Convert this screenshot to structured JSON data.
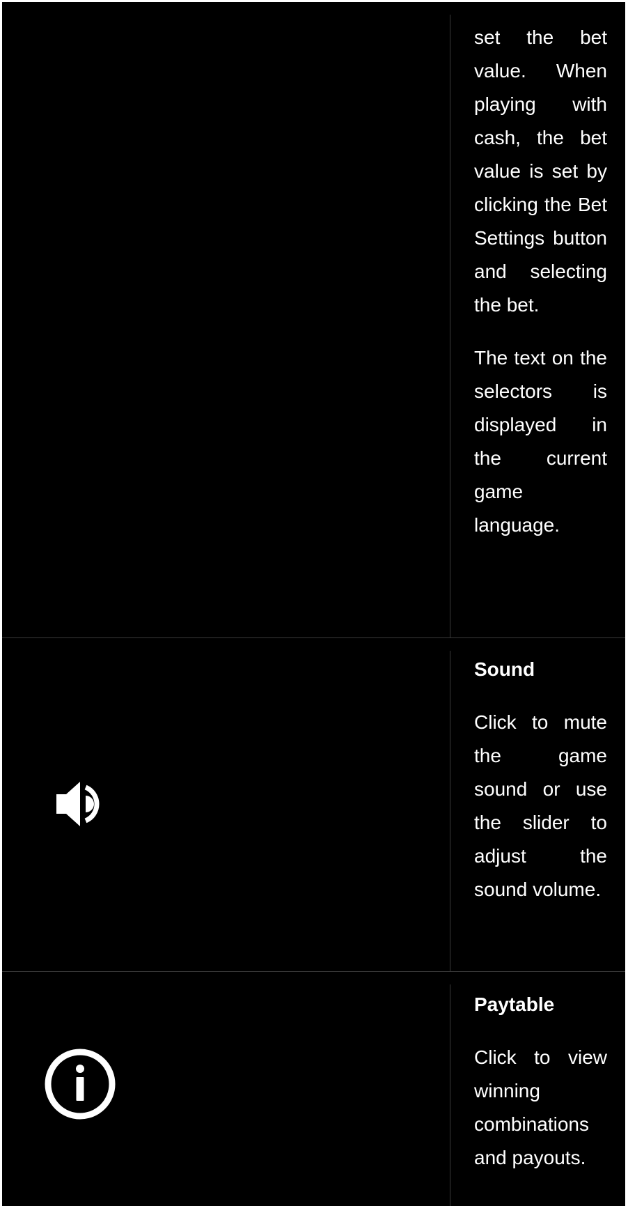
{
  "rows": [
    {
      "paragraphs": [
        "set the bet value. When playing with cash, the bet value is set by clicking the Bet Settings button and selecting the bet.",
        "The text on the selectors is displayed in the current game language."
      ]
    },
    {
      "icon": "speaker-icon",
      "title": "Sound",
      "description": "Click to mute the game sound or use the slider to adjust the sound volume."
    },
    {
      "icon": "info-icon",
      "title": "Paytable",
      "description": "Click to view winning combinations and payouts."
    }
  ],
  "colors": {
    "background": "#000000",
    "text": "#ffffff",
    "divider": "#3a3a3a",
    "page": "#ffffff"
  }
}
